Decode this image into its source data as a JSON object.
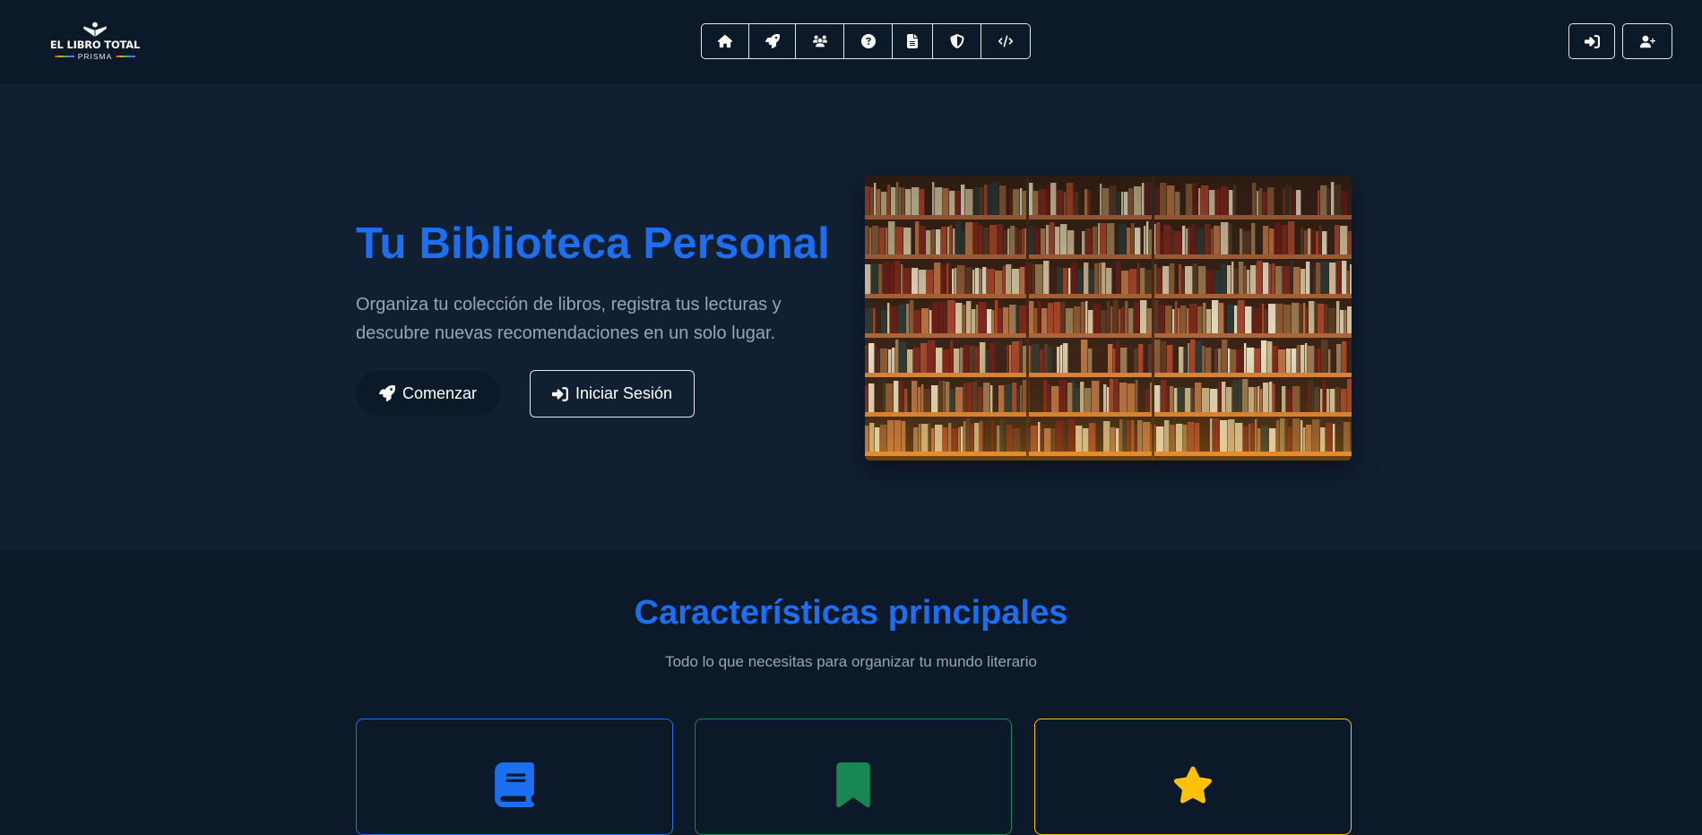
{
  "brand": {
    "title": "EL LIBRO TOTAL",
    "subtitle": "PRISMA"
  },
  "nav": {
    "items": [
      {
        "icon": "home-icon",
        "width": 53
      },
      {
        "icon": "rocket-icon",
        "width": 52
      },
      {
        "icon": "users-icon",
        "width": 54
      },
      {
        "icon": "question-icon",
        "width": 54
      },
      {
        "icon": "file-icon",
        "width": 45
      },
      {
        "icon": "shield-icon",
        "width": 54
      },
      {
        "icon": "code-icon",
        "width": 54
      }
    ],
    "auth": [
      {
        "icon": "sign-in-icon"
      },
      {
        "icon": "user-plus-icon"
      }
    ]
  },
  "hero": {
    "title": "Tu Biblioteca Personal",
    "description": "Organiza tu colección de libros, registra tus lecturas y descubre nuevas recomendaciones en un solo lugar.",
    "start_label": "Comenzar",
    "login_label": "Iniciar Sesión"
  },
  "features": {
    "title": "Características principales",
    "subtitle": "Todo lo que necesitas para organizar tu mundo literario",
    "cards": [
      {
        "icon": "book-icon",
        "color": "#1d6ff2"
      },
      {
        "icon": "bookmark-icon",
        "color": "#198754"
      },
      {
        "icon": "star-icon",
        "color": "#ffc107"
      }
    ]
  },
  "colors": {
    "accent": "#1d6ff2",
    "background": "#0b1929",
    "hero_background": "#111f32",
    "muted_text": "#9aa5b4"
  }
}
